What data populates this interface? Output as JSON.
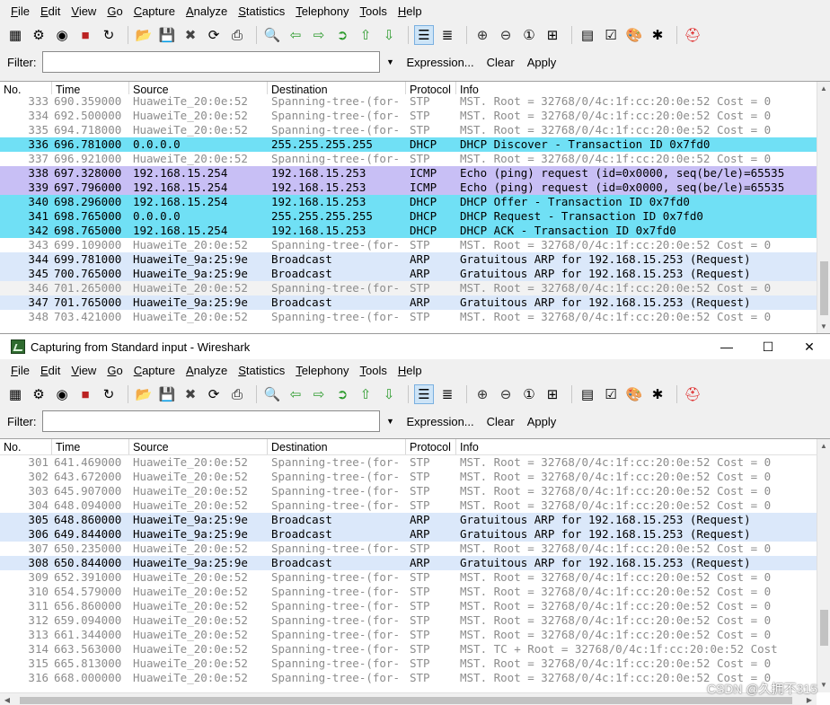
{
  "window_back": {
    "menu": [
      "File",
      "Edit",
      "View",
      "Go",
      "Capture",
      "Analyze",
      "Statistics",
      "Telephony",
      "Tools",
      "Help"
    ],
    "filter": {
      "label": "Filter:",
      "value": "",
      "expression": "Expression...",
      "clear": "Clear",
      "apply": "Apply"
    },
    "columns": [
      "No.",
      "Time",
      "Source",
      "Destination",
      "Protocol",
      "Info"
    ],
    "packets": [
      {
        "no": "333",
        "time": "690.359000",
        "src": "HuaweiTe_20:0e:52",
        "dst": "Spanning-tree-(for-",
        "proto": "STP",
        "info": "MST. Root = 32768/0/4c:1f:cc:20:0e:52  Cost = 0",
        "cls": "stp"
      },
      {
        "no": "334",
        "time": "692.500000",
        "src": "HuaweiTe_20:0e:52",
        "dst": "Spanning-tree-(for-",
        "proto": "STP",
        "info": "MST. Root = 32768/0/4c:1f:cc:20:0e:52  Cost = 0",
        "cls": "stp"
      },
      {
        "no": "335",
        "time": "694.718000",
        "src": "HuaweiTe_20:0e:52",
        "dst": "Spanning-tree-(for-",
        "proto": "STP",
        "info": "MST. Root = 32768/0/4c:1f:cc:20:0e:52  Cost = 0",
        "cls": "stp"
      },
      {
        "no": "336",
        "time": "696.781000",
        "src": "0.0.0.0",
        "dst": "255.255.255.255",
        "proto": "DHCP",
        "info": "DHCP Discover - Transaction ID 0x7fd0",
        "cls": "dhcp"
      },
      {
        "no": "337",
        "time": "696.921000",
        "src": "HuaweiTe_20:0e:52",
        "dst": "Spanning-tree-(for-",
        "proto": "STP",
        "info": "MST. Root = 32768/0/4c:1f:cc:20:0e:52  Cost = 0",
        "cls": "stp"
      },
      {
        "no": "338",
        "time": "697.328000",
        "src": "192.168.15.254",
        "dst": "192.168.15.253",
        "proto": "ICMP",
        "info": "Echo (ping) request  (id=0x0000, seq(be/le)=65535",
        "cls": "icmp"
      },
      {
        "no": "339",
        "time": "697.796000",
        "src": "192.168.15.254",
        "dst": "192.168.15.253",
        "proto": "ICMP",
        "info": "Echo (ping) request  (id=0x0000, seq(be/le)=65535",
        "cls": "icmp"
      },
      {
        "no": "340",
        "time": "698.296000",
        "src": "192.168.15.254",
        "dst": "192.168.15.253",
        "proto": "DHCP",
        "info": "DHCP Offer    - Transaction ID 0x7fd0",
        "cls": "dhcp"
      },
      {
        "no": "341",
        "time": "698.765000",
        "src": "0.0.0.0",
        "dst": "255.255.255.255",
        "proto": "DHCP",
        "info": "DHCP Request  - Transaction ID 0x7fd0",
        "cls": "dhcp"
      },
      {
        "no": "342",
        "time": "698.765000",
        "src": "192.168.15.254",
        "dst": "192.168.15.253",
        "proto": "DHCP",
        "info": "DHCP ACK      - Transaction ID 0x7fd0",
        "cls": "dhcp"
      },
      {
        "no": "343",
        "time": "699.109000",
        "src": "HuaweiTe_20:0e:52",
        "dst": "Spanning-tree-(for-",
        "proto": "STP",
        "info": "MST. Root = 32768/0/4c:1f:cc:20:0e:52  Cost = 0",
        "cls": "stp"
      },
      {
        "no": "344",
        "time": "699.781000",
        "src": "HuaweiTe_9a:25:9e",
        "dst": "Broadcast",
        "proto": "ARP",
        "info": "Gratuitous ARP for 192.168.15.253 (Request)",
        "cls": "arp"
      },
      {
        "no": "345",
        "time": "700.765000",
        "src": "HuaweiTe_9a:25:9e",
        "dst": "Broadcast",
        "proto": "ARP",
        "info": "Gratuitous ARP for 192.168.15.253 (Request)",
        "cls": "arp"
      },
      {
        "no": "346",
        "time": "701.265000",
        "src": "HuaweiTe_20:0e:52",
        "dst": "Spanning-tree-(for-",
        "proto": "STP",
        "info": "MST. Root = 32768/0/4c:1f:cc:20:0e:52  Cost = 0",
        "cls": "stp2"
      },
      {
        "no": "347",
        "time": "701.765000",
        "src": "HuaweiTe_9a:25:9e",
        "dst": "Broadcast",
        "proto": "ARP",
        "info": "Gratuitous ARP for 192.168.15.253 (Request)",
        "cls": "arp"
      },
      {
        "no": "348",
        "time": "703.421000",
        "src": "HuaweiTe_20:0e:52",
        "dst": "Spanning-tree-(for-",
        "proto": "STP",
        "info": "MST. Root = 32768/0/4c:1f:cc:20:0e:52  Cost = 0",
        "cls": "stp"
      }
    ]
  },
  "window_front": {
    "title": "Capturing from Standard input - Wireshark",
    "controls": {
      "minimize": "—",
      "maximize": "☐",
      "close": "✕"
    },
    "menu": [
      "File",
      "Edit",
      "View",
      "Go",
      "Capture",
      "Analyze",
      "Statistics",
      "Telephony",
      "Tools",
      "Help"
    ],
    "filter": {
      "label": "Filter:",
      "value": "",
      "expression": "Expression...",
      "clear": "Clear",
      "apply": "Apply"
    },
    "columns": [
      "No.",
      "Time",
      "Source",
      "Destination",
      "Protocol",
      "Info"
    ],
    "packets": [
      {
        "no": "301",
        "time": "641.469000",
        "src": "HuaweiTe_20:0e:52",
        "dst": "Spanning-tree-(for-",
        "proto": "STP",
        "info": "MST. Root = 32768/0/4c:1f:cc:20:0e:52  Cost = 0",
        "cls": "stp"
      },
      {
        "no": "302",
        "time": "643.672000",
        "src": "HuaweiTe_20:0e:52",
        "dst": "Spanning-tree-(for-",
        "proto": "STP",
        "info": "MST. Root = 32768/0/4c:1f:cc:20:0e:52  Cost = 0",
        "cls": "stp"
      },
      {
        "no": "303",
        "time": "645.907000",
        "src": "HuaweiTe_20:0e:52",
        "dst": "Spanning-tree-(for-",
        "proto": "STP",
        "info": "MST. Root = 32768/0/4c:1f:cc:20:0e:52  Cost = 0",
        "cls": "stp"
      },
      {
        "no": "304",
        "time": "648.094000",
        "src": "HuaweiTe_20:0e:52",
        "dst": "Spanning-tree-(for-",
        "proto": "STP",
        "info": "MST. Root = 32768/0/4c:1f:cc:20:0e:52  Cost = 0",
        "cls": "stp"
      },
      {
        "no": "305",
        "time": "648.860000",
        "src": "HuaweiTe_9a:25:9e",
        "dst": "Broadcast",
        "proto": "ARP",
        "info": "Gratuitous ARP for 192.168.15.253 (Request)",
        "cls": "arp"
      },
      {
        "no": "306",
        "time": "649.844000",
        "src": "HuaweiTe_9a:25:9e",
        "dst": "Broadcast",
        "proto": "ARP",
        "info": "Gratuitous ARP for 192.168.15.253 (Request)",
        "cls": "arp"
      },
      {
        "no": "307",
        "time": "650.235000",
        "src": "HuaweiTe_20:0e:52",
        "dst": "Spanning-tree-(for-",
        "proto": "STP",
        "info": "MST. Root = 32768/0/4c:1f:cc:20:0e:52  Cost = 0",
        "cls": "stp"
      },
      {
        "no": "308",
        "time": "650.844000",
        "src": "HuaweiTe_9a:25:9e",
        "dst": "Broadcast",
        "proto": "ARP",
        "info": "Gratuitous ARP for 192.168.15.253 (Request)",
        "cls": "arp"
      },
      {
        "no": "309",
        "time": "652.391000",
        "src": "HuaweiTe_20:0e:52",
        "dst": "Spanning-tree-(for-",
        "proto": "STP",
        "info": "MST. Root = 32768/0/4c:1f:cc:20:0e:52  Cost = 0",
        "cls": "stp"
      },
      {
        "no": "310",
        "time": "654.579000",
        "src": "HuaweiTe_20:0e:52",
        "dst": "Spanning-tree-(for-",
        "proto": "STP",
        "info": "MST. Root = 32768/0/4c:1f:cc:20:0e:52  Cost = 0",
        "cls": "stp"
      },
      {
        "no": "311",
        "time": "656.860000",
        "src": "HuaweiTe_20:0e:52",
        "dst": "Spanning-tree-(for-",
        "proto": "STP",
        "info": "MST. Root = 32768/0/4c:1f:cc:20:0e:52  Cost = 0",
        "cls": "stp"
      },
      {
        "no": "312",
        "time": "659.094000",
        "src": "HuaweiTe_20:0e:52",
        "dst": "Spanning-tree-(for-",
        "proto": "STP",
        "info": "MST. Root = 32768/0/4c:1f:cc:20:0e:52  Cost = 0",
        "cls": "stp"
      },
      {
        "no": "313",
        "time": "661.344000",
        "src": "HuaweiTe_20:0e:52",
        "dst": "Spanning-tree-(for-",
        "proto": "STP",
        "info": "MST. Root = 32768/0/4c:1f:cc:20:0e:52  Cost = 0",
        "cls": "stp"
      },
      {
        "no": "314",
        "time": "663.563000",
        "src": "HuaweiTe_20:0e:52",
        "dst": "Spanning-tree-(for-",
        "proto": "STP",
        "info": "MST. TC + Root = 32768/0/4c:1f:cc:20:0e:52  Cost",
        "cls": "stp"
      },
      {
        "no": "315",
        "time": "665.813000",
        "src": "HuaweiTe_20:0e:52",
        "dst": "Spanning-tree-(for-",
        "proto": "STP",
        "info": "MST. Root = 32768/0/4c:1f:cc:20:0e:52  Cost = 0",
        "cls": "stp"
      },
      {
        "no": "316",
        "time": "668.000000",
        "src": "HuaweiTe_20:0e:52",
        "dst": "Spanning-tree-(for-",
        "proto": "STP",
        "info": "MST. Root = 32768/0/4c:1f:cc:20:0e:52  Cost = 0",
        "cls": "stp"
      }
    ]
  },
  "toolbar_icons": [
    "interface-list-icon",
    "capture-options-icon",
    "start-capture-icon",
    "stop-capture-icon",
    "restart-capture-icon",
    "open-file-icon",
    "save-file-icon",
    "close-file-icon",
    "reload-icon",
    "print-icon",
    "find-icon",
    "go-back-icon",
    "go-forward-icon",
    "go-to-packet-icon",
    "go-first-icon",
    "go-last-icon",
    "colorize-icon",
    "autoscroll-icon",
    "zoom-in-icon",
    "zoom-out-icon",
    "normal-size-icon",
    "resize-columns-icon",
    "capture-filters-icon",
    "display-filters-icon",
    "coloring-rules-icon",
    "preferences-icon",
    "help-icon"
  ],
  "colors": {
    "dhcp": "#70e0f5",
    "icmp": "#c8bff5",
    "arp": "#dbe8fa",
    "stp_text": "#8c8c8c"
  },
  "watermark": "CSDN @久拥不315"
}
